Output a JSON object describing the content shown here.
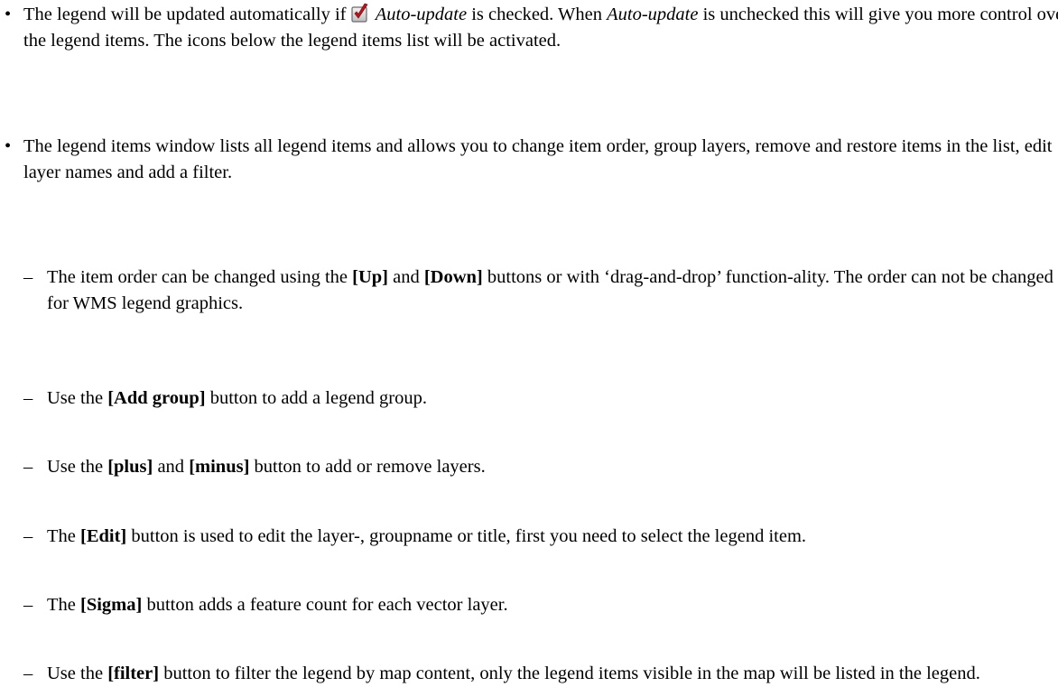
{
  "item1": {
    "t1": "The legend will be updated automatically if",
    "t2": " ",
    "auto_update": "Auto-update",
    "t3": " is checked. When ",
    "auto_update_2": "Auto-update",
    "t4": " is unchecked this will give you more control over the legend items. The icons below the legend items list will be activated."
  },
  "item2": {
    "text": "The legend items window lists all legend items and allows you to change item order, group layers, remove and restore items in the list, edit layer names and add a filter."
  },
  "sub": [
    {
      "a": "The item order can be changed using the ",
      "b1": "[Up]",
      "c": " and ",
      "b2": "[Down]",
      "d": " buttons or with ‘drag-and-drop’ function-ality. The order can not be changed for WMS legend graphics."
    },
    {
      "a": "Use the ",
      "b1": "[Add group]",
      "d": " button to add a legend group."
    },
    {
      "a": "Use the ",
      "b1": "[plus]",
      "c": " and ",
      "b2": "[minus]",
      "d": " button to add or remove layers."
    },
    {
      "a": "The ",
      "b1": "[Edit]",
      "d": " button is used to edit the layer-, groupname or title, first you need to select the legend item."
    },
    {
      "a": "The ",
      "b1": "[Sigma]",
      "d": " button adds a feature count for each vector layer."
    },
    {
      "a": "Use the ",
      "b1": "[filter]",
      "d": " button to filter the legend by map content, only the legend items visible in the map will be listed in the legend."
    }
  ],
  "bullet": "•",
  "dash": "–",
  "icons": {
    "checkbox": "checked-checkbox-icon"
  }
}
